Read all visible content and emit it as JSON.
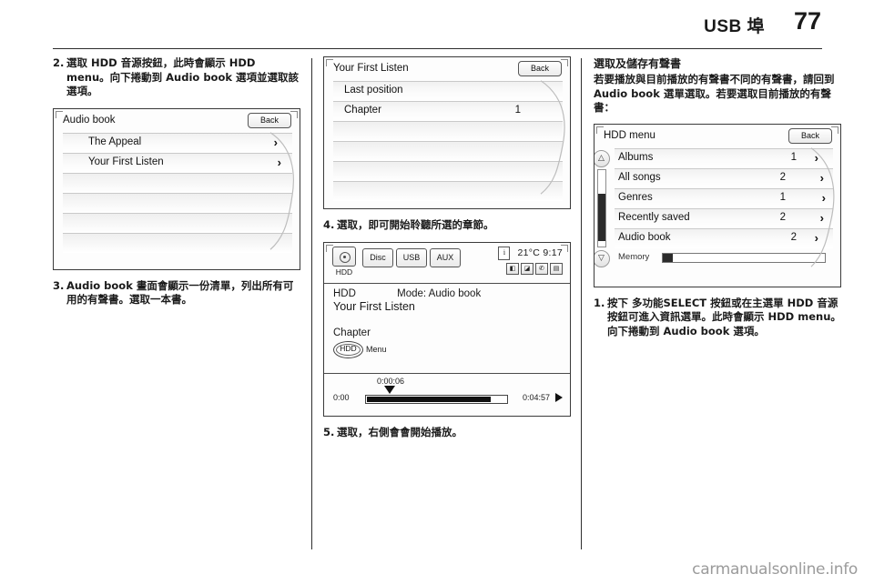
{
  "header": {
    "title": "USB 埠",
    "page_number": "77"
  },
  "column_left": {
    "step2": {
      "number": "2.",
      "text": "選取 HDD 音源按鈕，此時會顯示 HDD menu。向下捲動到 Audio book 選項並選取該選項。"
    },
    "screen_audio_book": {
      "title": "Audio book",
      "back_label": "Back",
      "rows": [
        {
          "label": "The Appeal",
          "chevron": "›"
        },
        {
          "label": "Your First Listen",
          "chevron": "›"
        }
      ],
      "empty_rows": 4
    },
    "step3": {
      "number": "3.",
      "text": "Audio book 畫面會顯示一份清單，列出所有可用的有聲書。選取一本書。"
    }
  },
  "column_middle": {
    "screen_first_listen": {
      "title": "Your First Listen",
      "back_label": "Back",
      "rows": [
        {
          "label": "Last position",
          "value": ""
        },
        {
          "label": "Chapter",
          "value": "1"
        }
      ],
      "empty_rows": 4
    },
    "step4": {
      "number": "4.",
      "text": "選取，即可開始聆聽所選的章節。"
    },
    "screen_player": {
      "sources": {
        "hdd_label": "HDD",
        "tabs": [
          "Disc",
          "USB",
          "AUX"
        ]
      },
      "status": {
        "info_glyph": "i",
        "temperature": "21°C",
        "time": "9:17",
        "icons": [
          "mute-icon",
          "phone-mute-icon",
          "phone-icon",
          "battery-icon"
        ]
      },
      "source_name": "HDD",
      "mode_label": "Mode: Audio book",
      "track_title": "Your First Listen",
      "chapter_label": "Chapter",
      "knob_label": "HDD",
      "menu_label": "Menu",
      "progress": {
        "current_position": "0:00:06",
        "start_time": "0:00",
        "end_time": "0:04:57",
        "percent": 88
      }
    },
    "step5": {
      "number": "5.",
      "text": "選取，右側會會開始播放。"
    }
  },
  "column_right": {
    "section_title": "選取及儲存有聲書",
    "paragraph": "若要播放與目前播放的有聲書不同的有聲書，請回到 Audio book 選單選取。若要選取目前播放的有聲書：",
    "screen_hdd_menu": {
      "title": "HDD menu",
      "back_label": "Back",
      "scroll_up": "△",
      "scroll_down": "▽",
      "rows": [
        {
          "label": "Albums",
          "value": "1",
          "chevron": "›"
        },
        {
          "label": "All songs",
          "value": "2",
          "chevron": "›"
        },
        {
          "label": "Genres",
          "value": "1",
          "chevron": "›"
        },
        {
          "label": "Recently saved",
          "value": "2",
          "chevron": "›"
        },
        {
          "label": "Audio book",
          "value": "2",
          "chevron": "›"
        }
      ],
      "memory": {
        "label": "Memory",
        "percent": 6
      }
    },
    "step1": {
      "number": "1.",
      "text": "按下 多功能SELECT 按鈕或在主選單 HDD 音源按鈕可進入資訊選單。此時會顯示 HDD menu。向下捲動到 Audio book 選項。"
    }
  },
  "watermark": "carmanualsonline.info"
}
